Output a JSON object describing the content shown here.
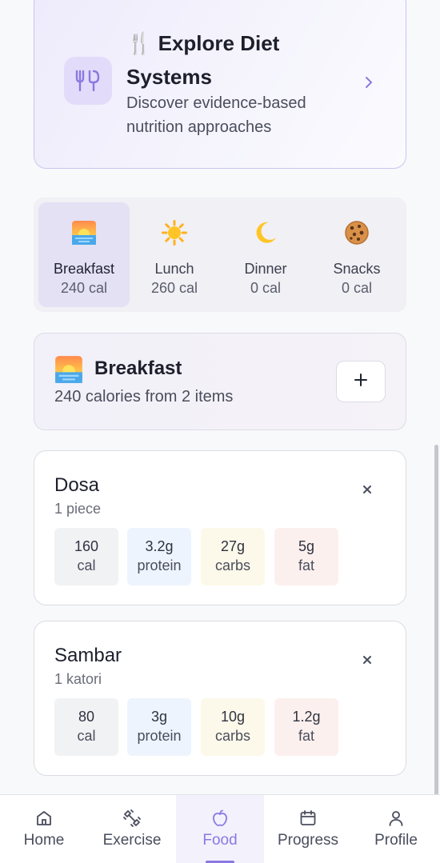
{
  "explore": {
    "title": "🍴 Explore Diet Systems",
    "subtitle": "Discover evidence-based nutrition approaches",
    "icon": "fork-knife-icon",
    "accent": "#8b79e0"
  },
  "meal_tabs": [
    {
      "name": "Breakfast",
      "cal": "240 cal",
      "icon": "sunrise-icon",
      "active": true
    },
    {
      "name": "Lunch",
      "cal": "260 cal",
      "icon": "sun-icon",
      "active": false
    },
    {
      "name": "Dinner",
      "cal": "0 cal",
      "icon": "moon-icon",
      "active": false
    },
    {
      "name": "Snacks",
      "cal": "0 cal",
      "icon": "cookie-icon",
      "active": false
    }
  ],
  "meal": {
    "title": "Breakfast",
    "summary": "240 calories from 2 items",
    "add_label": "+"
  },
  "foods": [
    {
      "name": "Dosa",
      "qty": "1 piece",
      "cal": "160",
      "cal_unit": "cal",
      "protein": "3.2g",
      "protein_unit": "protein",
      "carbs": "27g",
      "carbs_unit": "carbs",
      "fat": "5g",
      "fat_unit": "fat"
    },
    {
      "name": "Sambar",
      "qty": "1 katori",
      "cal": "80",
      "cal_unit": "cal",
      "protein": "3g",
      "protein_unit": "protein",
      "carbs": "10g",
      "carbs_unit": "carbs",
      "fat": "1.2g",
      "fat_unit": "fat"
    }
  ],
  "nav": [
    {
      "label": "Home",
      "icon": "home-icon",
      "active": false
    },
    {
      "label": "Exercise",
      "icon": "dumbbell-icon",
      "active": false
    },
    {
      "label": "Food",
      "icon": "apple-icon",
      "active": true
    },
    {
      "label": "Progress",
      "icon": "calendar-icon",
      "active": false
    },
    {
      "label": "Profile",
      "icon": "user-icon",
      "active": false
    }
  ]
}
